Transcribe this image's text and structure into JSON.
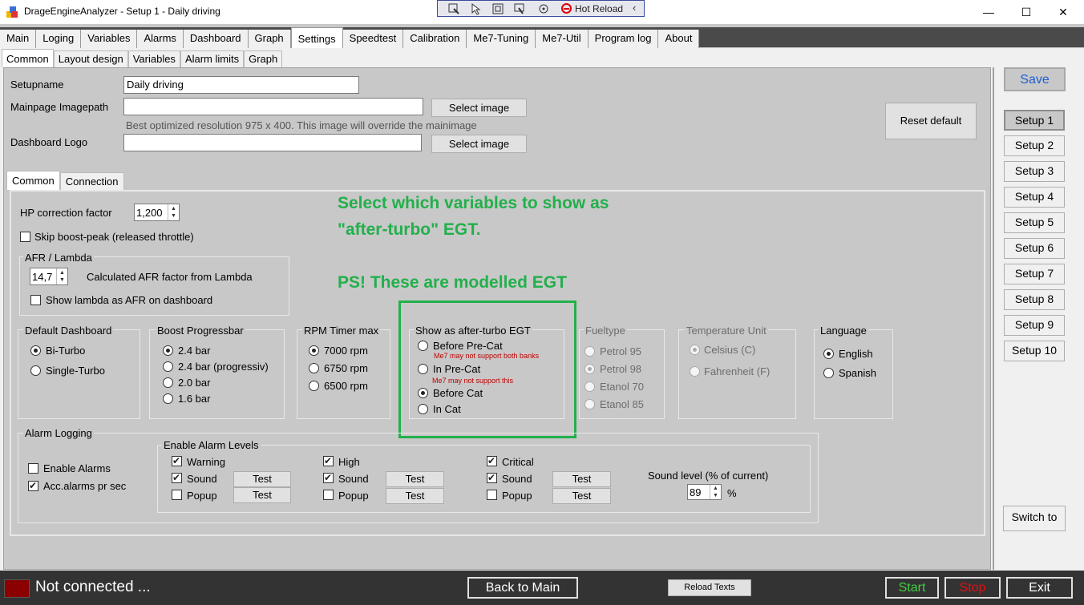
{
  "window": {
    "title": "DrageEngineAnalyzer - Setup 1 - Daily driving",
    "minimize": "—",
    "maximize": "☐",
    "close": "✕"
  },
  "debug_toolbar": {
    "hot_reload": "Hot Reload",
    "chevron": "‹"
  },
  "main_tabs": [
    "Main",
    "Loging",
    "Variables",
    "Alarms",
    "Dashboard",
    "Graph",
    "Settings",
    "Speedtest",
    "Calibration",
    "Me7-Tuning",
    "Me7-Util",
    "Program log",
    "About"
  ],
  "sub_tabs": [
    "Common",
    "Layout design",
    "Variables",
    "Alarm limits",
    "Graph"
  ],
  "setup": {
    "setupname_label": "Setupname",
    "setupname_value": "Daily driving",
    "mainpage_label": "Mainpage Imagepath",
    "mainpage_value": "",
    "select_image": "Select image",
    "hint": "Best optimized resolution 975 x 400.  This image will override the mainimage",
    "logo_label": "Dashboard Logo",
    "logo_value": "",
    "reset_default": "Reset default"
  },
  "inner_tabs": [
    "Common",
    "Connection"
  ],
  "common": {
    "hp_label": "HP correction factor",
    "hp_value": "1,200",
    "skip_boost": "Skip boost-peak (released throttle)",
    "afr_group": "AFR / Lambda",
    "afr_value": "14,7",
    "afr_desc": "Calculated  AFR factor from Lambda",
    "lambda_as_afr": "Show lambda as AFR on dashboard"
  },
  "annotation": {
    "line1": "Select which variables to show as",
    "line2": "\"after-turbo\" EGT.",
    "line3": "PS! These are modelled EGT"
  },
  "default_dashboard": {
    "title": "Default Dashboard",
    "options": [
      "Bi-Turbo",
      "Single-Turbo"
    ],
    "selected": 0
  },
  "boost_bar": {
    "title": "Boost Progressbar",
    "options": [
      "2.4 bar",
      "2.4 bar (progressiv)",
      "2.0 bar",
      "1.6  bar"
    ],
    "selected": 0
  },
  "rpm_timer": {
    "title": "RPM Timer max",
    "options": [
      "7000 rpm",
      "6750 rpm",
      "6500 rpm"
    ],
    "selected": 0
  },
  "egt": {
    "title": "Show as after-turbo EGT",
    "options": [
      "Before Pre-Cat",
      "In Pre-Cat",
      "Before Cat",
      "In Cat"
    ],
    "warn1": "Me7 may not support both banks",
    "warn2": "Me7 may not support this",
    "selected": 2
  },
  "fueltype": {
    "title": "Fueltype",
    "options": [
      "Petrol 95",
      "Petrol 98",
      "Etanol 70",
      "Etanol 85"
    ],
    "selected": 1
  },
  "temp_unit": {
    "title": "Temperature Unit",
    "options": [
      "Celsius (C)",
      "Fahrenheit (F)"
    ],
    "selected": 0
  },
  "language": {
    "title": "Language",
    "options": [
      "English",
      "Spanish"
    ],
    "selected": 0
  },
  "alarm_logging": {
    "title": "Alarm Logging",
    "enable_alarms": "Enable Alarms",
    "acc_alarms": "Acc.alarms pr sec",
    "levels_title": "Enable Alarm Levels",
    "warning": "Warning",
    "high": "High",
    "critical": "Critical",
    "sound": "Sound",
    "popup": "Popup",
    "test": "Test",
    "sound_level_label": "Sound level (% of current)",
    "sound_level_value": "89",
    "percent": "%"
  },
  "right": {
    "save": "Save",
    "setups": [
      "Setup 1",
      "Setup 2",
      "Setup 3",
      "Setup 4",
      "Setup 5",
      "Setup 6",
      "Setup 7",
      "Setup 8",
      "Setup 9",
      "Setup 10"
    ],
    "switch_to": "Switch to"
  },
  "bottom": {
    "status": "Not connected ...",
    "back_to_main": "Back to Main",
    "reload_texts": "Reload Texts",
    "start": "Start",
    "stop": "Stop",
    "exit": "Exit"
  },
  "colors": {
    "annotation_green": "#22b04b",
    "start_green": "#3ed13e",
    "stop_red": "#e01010",
    "save_blue": "#1f5fd1",
    "led_red": "#8b0000"
  }
}
